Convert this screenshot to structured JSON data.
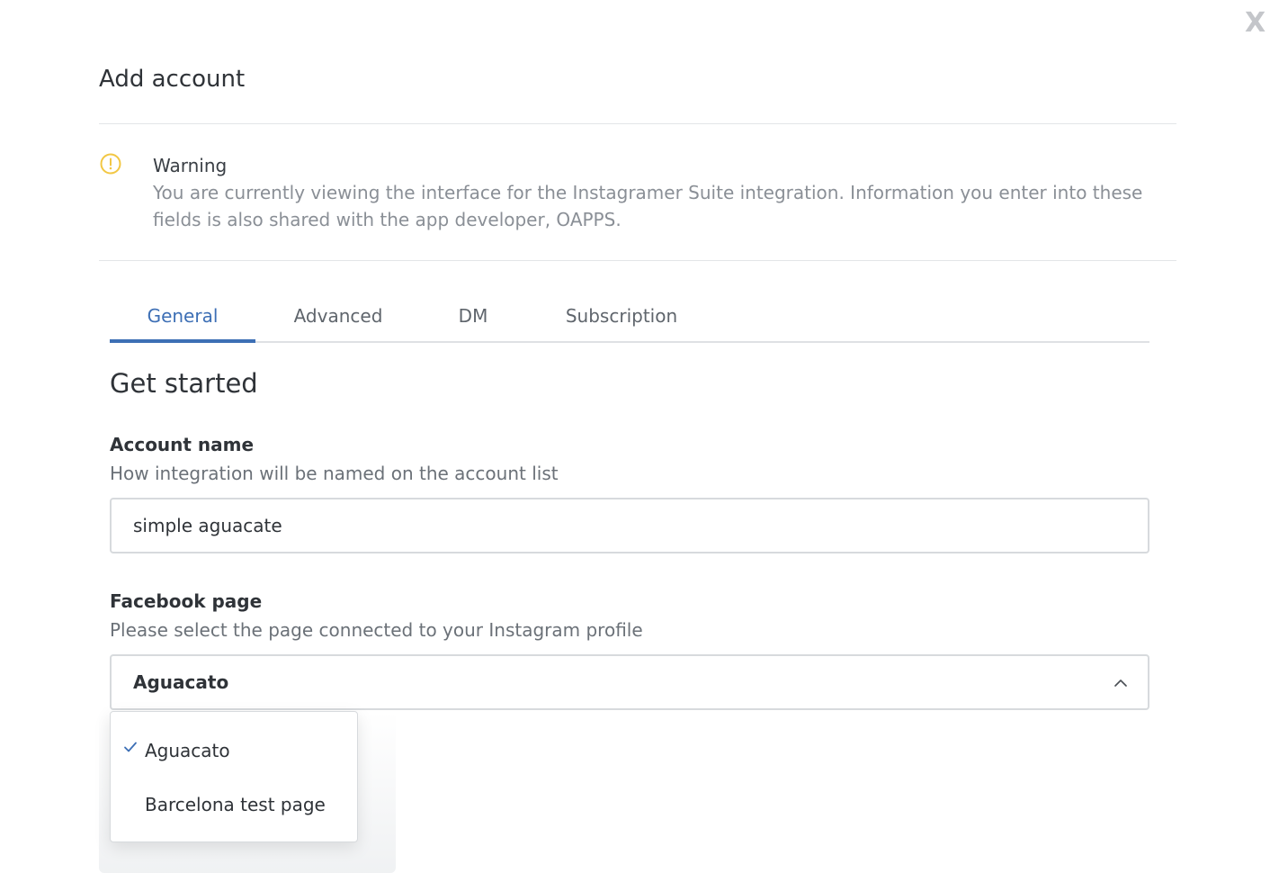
{
  "dialog": {
    "title": "Add account",
    "close_label": "X"
  },
  "warning": {
    "icon": "exclamation-circle-icon",
    "title": "Warning",
    "text": "You are currently viewing the interface for the Instagramer Suite integration. Information you enter into these fields is also shared with the app developer, OAPPS.",
    "color": "#f2c744"
  },
  "tabs": [
    {
      "label": "General",
      "active": true
    },
    {
      "label": "Advanced",
      "active": false
    },
    {
      "label": "DM",
      "active": false
    },
    {
      "label": "Subscription",
      "active": false
    }
  ],
  "section": {
    "title": "Get started"
  },
  "account_name": {
    "label": "Account name",
    "help": "How integration will be named on the account list",
    "value": "simple aguacate"
  },
  "facebook_page": {
    "label": "Facebook page",
    "help": "Please select the page connected to your Instagram profile",
    "selected": "Aguacato",
    "options": [
      {
        "label": "Aguacato",
        "selected": true
      },
      {
        "label": "Barcelona test page",
        "selected": false
      }
    ]
  },
  "colors": {
    "accent": "#3d6fb5",
    "text": "#2f3338",
    "muted": "#8a8f96"
  }
}
